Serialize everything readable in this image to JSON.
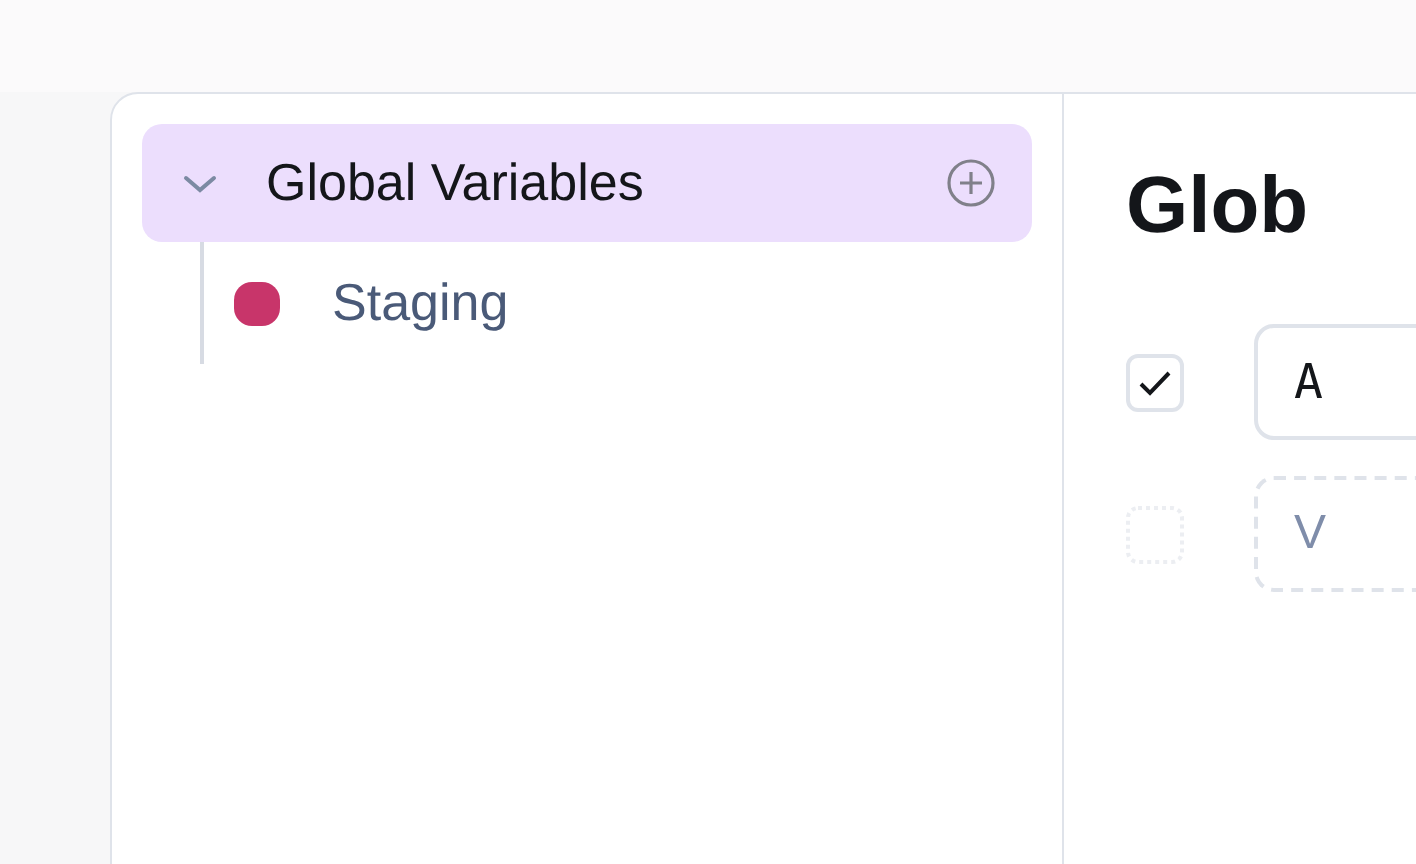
{
  "tree": [
    {
      "label": "Global Variables",
      "expanded": true,
      "selected": true,
      "children": [
        {
          "label": "Staging",
          "color": "#c8356a",
          "selected": false
        }
      ]
    }
  ],
  "detail": {
    "title": "Glob",
    "rows": [
      {
        "kind": "filled",
        "checked": true,
        "value": "A"
      },
      {
        "kind": "new",
        "checked": false,
        "placeholder": "V"
      }
    ]
  }
}
